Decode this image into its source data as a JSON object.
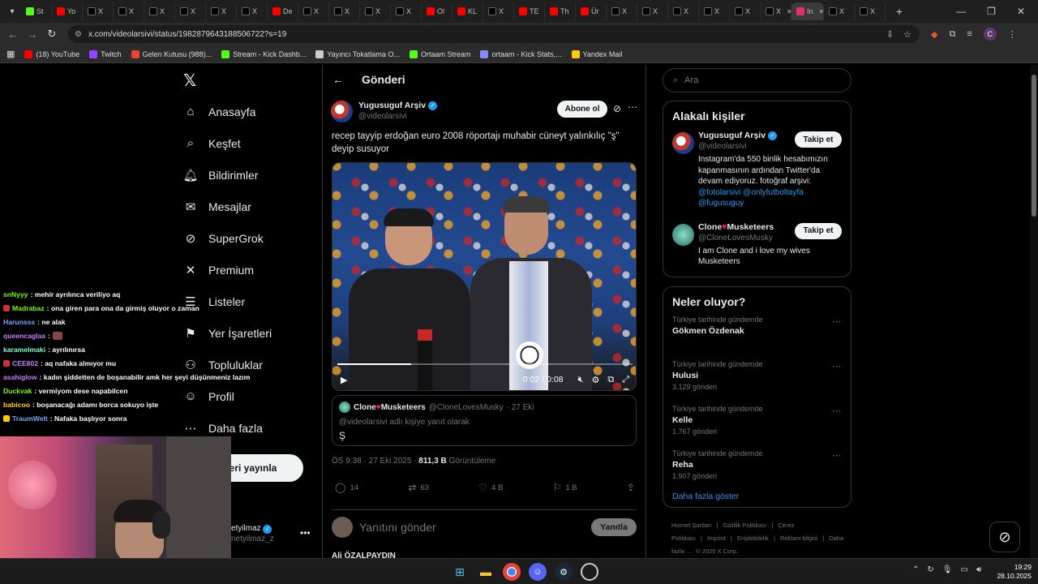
{
  "browser": {
    "tabs": [
      {
        "label": "St",
        "color": "#53fc18"
      },
      {
        "label": "Yo",
        "color": "#ff0000"
      },
      {
        "label": "X",
        "color": "#000000"
      },
      {
        "label": "X",
        "color": "#000000"
      },
      {
        "label": "X",
        "color": "#000000"
      },
      {
        "label": "X",
        "color": "#000000"
      },
      {
        "label": "X",
        "color": "#000000"
      },
      {
        "label": "X",
        "color": "#000000"
      },
      {
        "label": "De",
        "color": "#ff0000"
      },
      {
        "label": "X",
        "color": "#000000"
      },
      {
        "label": "X",
        "color": "#000000"
      },
      {
        "label": "X",
        "color": "#000000"
      },
      {
        "label": "X",
        "color": "#000000"
      },
      {
        "label": "Ol",
        "color": "#ff0000"
      },
      {
        "label": "KL",
        "color": "#ff0000"
      },
      {
        "label": "X",
        "color": "#000000"
      },
      {
        "label": "TE",
        "color": "#ff0000"
      },
      {
        "label": "Th",
        "color": "#ff0000"
      },
      {
        "label": "Ür",
        "color": "#ff0000"
      },
      {
        "label": "X",
        "color": "#000000"
      },
      {
        "label": "X",
        "color": "#000000"
      },
      {
        "label": "X",
        "color": "#000000"
      },
      {
        "label": "X",
        "color": "#000000"
      },
      {
        "label": "X",
        "color": "#000000"
      },
      {
        "label": "X",
        "color": "#000000"
      },
      {
        "label": "In",
        "color": "#e1306c"
      },
      {
        "label": "X",
        "color": "#000000"
      },
      {
        "label": "X",
        "color": "#000000"
      }
    ],
    "url": "x.com/videolarsivi/status/1982879643188506722?s=19",
    "profile_initial": "C",
    "bookmarks": [
      {
        "label": "(18) YouTube",
        "color": "#ff0000"
      },
      {
        "label": "Twitch",
        "color": "#9146ff"
      },
      {
        "label": "Gelen Kutusu (988)...",
        "color": "#ea4335"
      },
      {
        "label": "Stream - Kick Dashb...",
        "color": "#53fc18"
      },
      {
        "label": "Yayıncı Tokatlama O...",
        "color": "#cccccc"
      },
      {
        "label": "Ortaam Stream",
        "color": "#53fc18"
      },
      {
        "label": "ortaam - Kick Stats,...",
        "color": "#8888ff"
      },
      {
        "label": "Yandex Mail",
        "color": "#ffcc00"
      }
    ]
  },
  "nav": {
    "items": [
      {
        "label": "Anasayfa",
        "icon": "home-icon",
        "glyph": "⌂"
      },
      {
        "label": "Keşfet",
        "icon": "search-icon",
        "glyph": "⌕"
      },
      {
        "label": "Bildirimler",
        "icon": "bell-icon",
        "glyph": "🔔︎"
      },
      {
        "label": "Mesajlar",
        "icon": "mail-icon",
        "glyph": "✉"
      },
      {
        "label": "SuperGrok",
        "icon": "grok-icon",
        "glyph": "⊘"
      },
      {
        "label": "Premium",
        "icon": "x-premium-icon",
        "glyph": "✕"
      },
      {
        "label": "Listeler",
        "icon": "list-icon",
        "glyph": "☰"
      },
      {
        "label": "Yer İşaretleri",
        "icon": "bookmark-icon",
        "glyph": "⚑"
      },
      {
        "label": "Topluluklar",
        "icon": "communities-icon",
        "glyph": "⚇"
      },
      {
        "label": "Profil",
        "icon": "profile-icon",
        "glyph": "☺"
      },
      {
        "label": "Daha fazla",
        "icon": "more-circle-icon",
        "glyph": "⋯"
      }
    ],
    "post_button": "eri yayınla",
    "account_name": "etyilmaz",
    "account_handle": "netyilmaz_z"
  },
  "chat": [
    {
      "user": "snNyyy",
      "color": "#7cfc00",
      "text": ": mehir ayrılınca veriliyo aq"
    },
    {
      "user": "Madrabaz",
      "color": "#7cfc00",
      "text": ": ona giren para ona da girmiş oluyor o zaman",
      "badge": "#cc3333"
    },
    {
      "user": "Harunsss",
      "color": "#6fa8ff",
      "text": ": ne alak"
    },
    {
      "user": "queencaglaa",
      "color": "#c77dff",
      "text": ":",
      "badge_after": "#884444"
    },
    {
      "user": "karamelmaki",
      "color": "#7fffd4",
      "text": ": ayrılınırsa"
    },
    {
      "user": "CEE802",
      "color": "#c77dff",
      "text": ": aq nafaka almıyor mu",
      "badge": "#cc3333"
    },
    {
      "user": "asahiglow",
      "color": "#c77dff",
      "text": ": kadın şiddetten de boşanabilir amk her şeyi düşünmeniz lazım"
    },
    {
      "user": "Duckvak",
      "color": "#7cfc00",
      "text": ": vermiyom dese napabilcen"
    },
    {
      "user": "babicoo",
      "color": "#ffd700",
      "text": ": boşanacağı adamı borca sokuyo işte"
    },
    {
      "user": "TraumWelt",
      "color": "#6fa8ff",
      "text": ": Nafaka başlıyor sonra",
      "badge": "#ffcc00"
    }
  ],
  "post": {
    "header_title": "Gönderi",
    "author_name": "Yugusuguf Arşiv",
    "author_handle": "@videolarsivi",
    "follow_label": "Abone ol",
    "text": "recep tayyip erdoğan euro 2008 röportajı muhabir cüneyt yalınkılıç \"ş\" deyip susuyor",
    "video": {
      "time": "0:02 / 0:08",
      "progress": 0.25
    },
    "quote": {
      "name_a": "Clone",
      "name_b": "Musketeers",
      "handle": "@CloneLovesMusky",
      "date": "· 27 Eki",
      "reply_to": "@videolarsivi adlı kişiye yanıt olarak",
      "text": "Ş"
    },
    "meta_time": "ÖS 9:38 · 27 Eki 2025 ·",
    "views_count": "811,3 B",
    "views_label": "Görüntüleme",
    "actions": {
      "replies": "14",
      "reposts": "63",
      "likes": "4 B",
      "bookmarks": "1 B"
    },
    "reply_placeholder": "Yanıtını gönder",
    "reply_button": "Yanıtla",
    "next_reply_author": "Ali ÖZALPAYDIN"
  },
  "sidebar": {
    "search_placeholder": "Ara",
    "related_title": "Alakalı kişiler",
    "people": [
      {
        "name": "Yugusuguf Arşiv",
        "handle": "@videolarsivi",
        "verified": true,
        "follow": "Takip et",
        "bio_text": "Instagram'da 550 binlik hesabımızın kapanmasının ardından Twitter'da devam ediyoruz. fotoğraf arşivi:",
        "bio_links": "@fotolarsivi @onlyfutboltayfa @fugusuguy"
      },
      {
        "name_a": "Clone",
        "name_b": "Musketeers",
        "handle": "@CloneLovesMusky",
        "follow": "Takip et",
        "bio_text": "I am Clone and i love my wives Musketeers"
      }
    ],
    "trends_title": "Neler oluyor?",
    "trends": [
      {
        "meta": "Türkiye tarihinde gündemde",
        "name": "Gökmen Özdenak",
        "count": ""
      },
      {
        "meta": "Türkiye tarihinde gündemde",
        "name": "Hulusi",
        "count": "3.129 gönderi"
      },
      {
        "meta": "Türkiye tarihinde gündemde",
        "name": "Kelle",
        "count": "1.767 gönderi"
      },
      {
        "meta": "Türkiye tarihinde gündemde",
        "name": "Reha",
        "count": "1.907 gönderi"
      }
    ],
    "show_more": "Daha fazla göster",
    "footer": [
      "Hizmet Şartları",
      "|",
      "Gizlilik Politikası",
      "|",
      "Çerez Politikası",
      "|",
      "Imprint",
      "|",
      "Erişilebilirlik",
      "|",
      "Reklam bilgisi",
      "|",
      "Daha fazla ...",
      "© 2025 X Corp."
    ]
  },
  "taskbar": {
    "time": "19:29",
    "date": "28.10.2025",
    "icons": [
      "windows-start-icon",
      "file-explorer-icon",
      "chrome-icon",
      "discord-icon",
      "steam-icon",
      "app-icon"
    ]
  },
  "colors": {
    "accent": "#1d9bf0",
    "border": "#2f3336",
    "muted": "#71767b",
    "text": "#e7e9ea"
  }
}
